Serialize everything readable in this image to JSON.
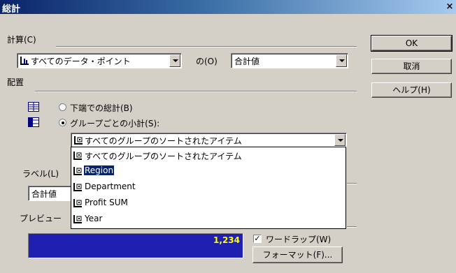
{
  "window": {
    "title": "総計",
    "close_glyph": "×"
  },
  "calc": {
    "label": "計算(C)",
    "target_combo": "すべてのデータ・ポイント",
    "of_label": "の(O)",
    "func_combo": "合計値"
  },
  "placement": {
    "label": "配置",
    "radio_bottom": "下端での総計(B)",
    "radio_group": "グループごとの小計(S):",
    "group_combo": "すべてのグループのソートされたアイテム",
    "options": [
      "すべてのグループのソートされたアイテム",
      "Region",
      "Department",
      "Profit SUM",
      "Year"
    ],
    "selected_index": 1
  },
  "label_section": {
    "label": "ラベル(L)",
    "value": "合計値"
  },
  "preview": {
    "label": "プレビュー",
    "value": "1,234"
  },
  "options": {
    "wordwrap_label": "ワードラップ(W)",
    "wordwrap_checked": "✓",
    "format_button": "フォーマット(F)..."
  },
  "buttons": {
    "ok": "OK",
    "cancel": "取消",
    "help": "ヘルプ(H)"
  },
  "colors": {
    "accent": "#0a246a",
    "preview_bg": "#2020b0",
    "preview_text": "#ffff00"
  }
}
